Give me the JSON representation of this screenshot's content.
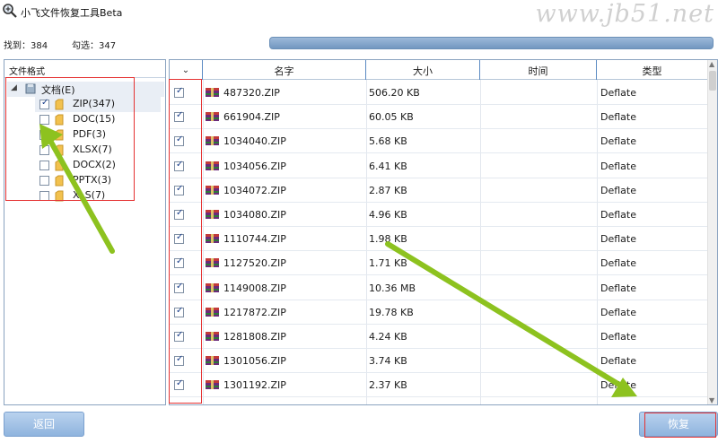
{
  "window": {
    "title": "小飞文件恢复工具Beta",
    "watermark": "www.jb51.net",
    "app_icon": "magnifier-icon"
  },
  "status": {
    "found_text": "找到：384",
    "checked_text": "勾选：347",
    "progress_percent": 100
  },
  "tree": {
    "header": "文件格式",
    "root": {
      "label": "文档(E)",
      "expanded": true,
      "icon": "folder-icon"
    },
    "items": [
      {
        "label": "ZIP(347)",
        "checked": true
      },
      {
        "label": "DOC(15)",
        "checked": false
      },
      {
        "label": "PDF(3)",
        "checked": false
      },
      {
        "label": "XLSX(7)",
        "checked": false
      },
      {
        "label": "DOCX(2)",
        "checked": false
      },
      {
        "label": "PPTX(3)",
        "checked": false
      },
      {
        "label": "XLS(7)",
        "checked": false
      }
    ]
  },
  "grid": {
    "select_all_icon": "chevron-down-icon",
    "columns": [
      "名字",
      "大小",
      "时间",
      "类型"
    ],
    "rows": [
      {
        "checked": true,
        "name": "487320.ZIP",
        "size": "506.20 KB",
        "time": "",
        "type": "Deflate"
      },
      {
        "checked": true,
        "name": "661904.ZIP",
        "size": "60.05 KB",
        "time": "",
        "type": "Deflate"
      },
      {
        "checked": true,
        "name": "1034040.ZIP",
        "size": "5.68 KB",
        "time": "",
        "type": "Deflate"
      },
      {
        "checked": true,
        "name": "1034056.ZIP",
        "size": "6.41 KB",
        "time": "",
        "type": "Deflate"
      },
      {
        "checked": true,
        "name": "1034072.ZIP",
        "size": "2.87 KB",
        "time": "",
        "type": "Deflate"
      },
      {
        "checked": true,
        "name": "1034080.ZIP",
        "size": "4.96 KB",
        "time": "",
        "type": "Deflate"
      },
      {
        "checked": true,
        "name": "1110744.ZIP",
        "size": "1.98 KB",
        "time": "",
        "type": "Deflate"
      },
      {
        "checked": true,
        "name": "1127520.ZIP",
        "size": "1.71 KB",
        "time": "",
        "type": "Deflate"
      },
      {
        "checked": true,
        "name": "1149008.ZIP",
        "size": "10.36 MB",
        "time": "",
        "type": "Deflate"
      },
      {
        "checked": true,
        "name": "1217872.ZIP",
        "size": "19.78 KB",
        "time": "",
        "type": "Deflate"
      },
      {
        "checked": true,
        "name": "1281808.ZIP",
        "size": "4.24 KB",
        "time": "",
        "type": "Deflate"
      },
      {
        "checked": true,
        "name": "1301056.ZIP",
        "size": "3.74 KB",
        "time": "",
        "type": "Deflate"
      },
      {
        "checked": true,
        "name": "1301192.ZIP",
        "size": "2.37 KB",
        "time": "",
        "type": "Deflate"
      }
    ]
  },
  "buttons": {
    "back_label": "返回",
    "recover_label": "恢复"
  },
  "colors": {
    "annotation_red": "#e53232",
    "arrow_green": "#8dc21f",
    "button_blue": "#8fb4de"
  }
}
